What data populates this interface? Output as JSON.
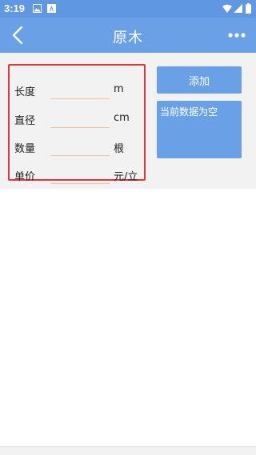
{
  "status_bar": {
    "time": "3:19"
  },
  "header": {
    "title": "原木",
    "back_icon": "chevron-left-icon",
    "more_icon": "more-horizontal-icon"
  },
  "form": {
    "rows": [
      {
        "label": "长度",
        "value": "",
        "unit": "m"
      },
      {
        "label": "直径",
        "value": "",
        "unit": "cm"
      },
      {
        "label": "数量",
        "value": "",
        "unit": "根"
      },
      {
        "label": "单价",
        "value": "",
        "unit": "元/立"
      }
    ]
  },
  "actions": {
    "add_label": "添加"
  },
  "data_panel": {
    "text": "当前数据为空"
  },
  "colors": {
    "accent": "#6aa1e6",
    "status_bar": "#5f97e3",
    "highlight_border": "#e0383e",
    "input_underline": "#f1c3a0",
    "content_bg": "#f2f2f2"
  }
}
